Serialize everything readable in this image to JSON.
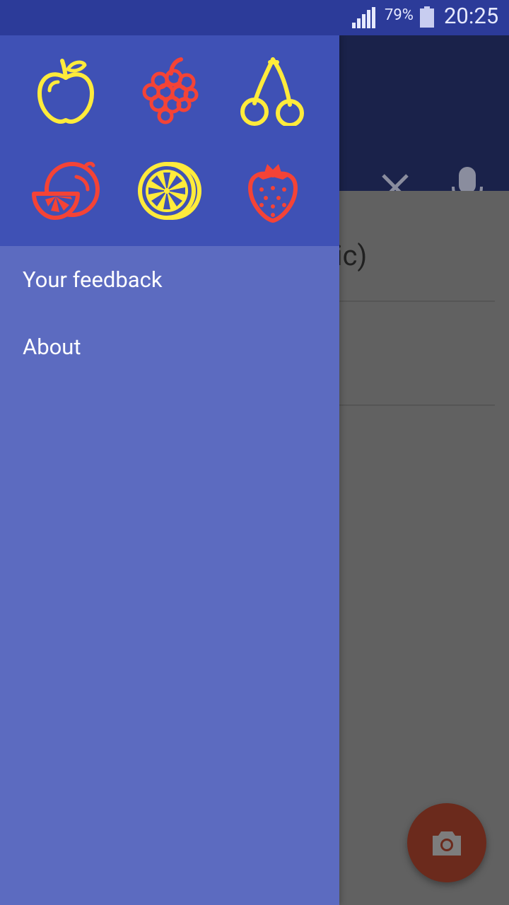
{
  "status_bar": {
    "battery_percent": "79%",
    "time": "20:25"
  },
  "drawer": {
    "header_icons": [
      "apple-icon",
      "grapes-icon",
      "cherries-icon",
      "grapefruit-icon",
      "lemon-slice-icon",
      "strawberry-icon"
    ],
    "menu": [
      {
        "label": "Your feedback"
      },
      {
        "label": "About"
      }
    ]
  },
  "background_app": {
    "partial_text": "eric)"
  },
  "colors": {
    "primary": "#3f51b5",
    "drawer_bg": "#5c6bc0",
    "status_bar": "#2c3b99",
    "yellow_icon": "#ffeb3b",
    "red_icon": "#f44336"
  }
}
